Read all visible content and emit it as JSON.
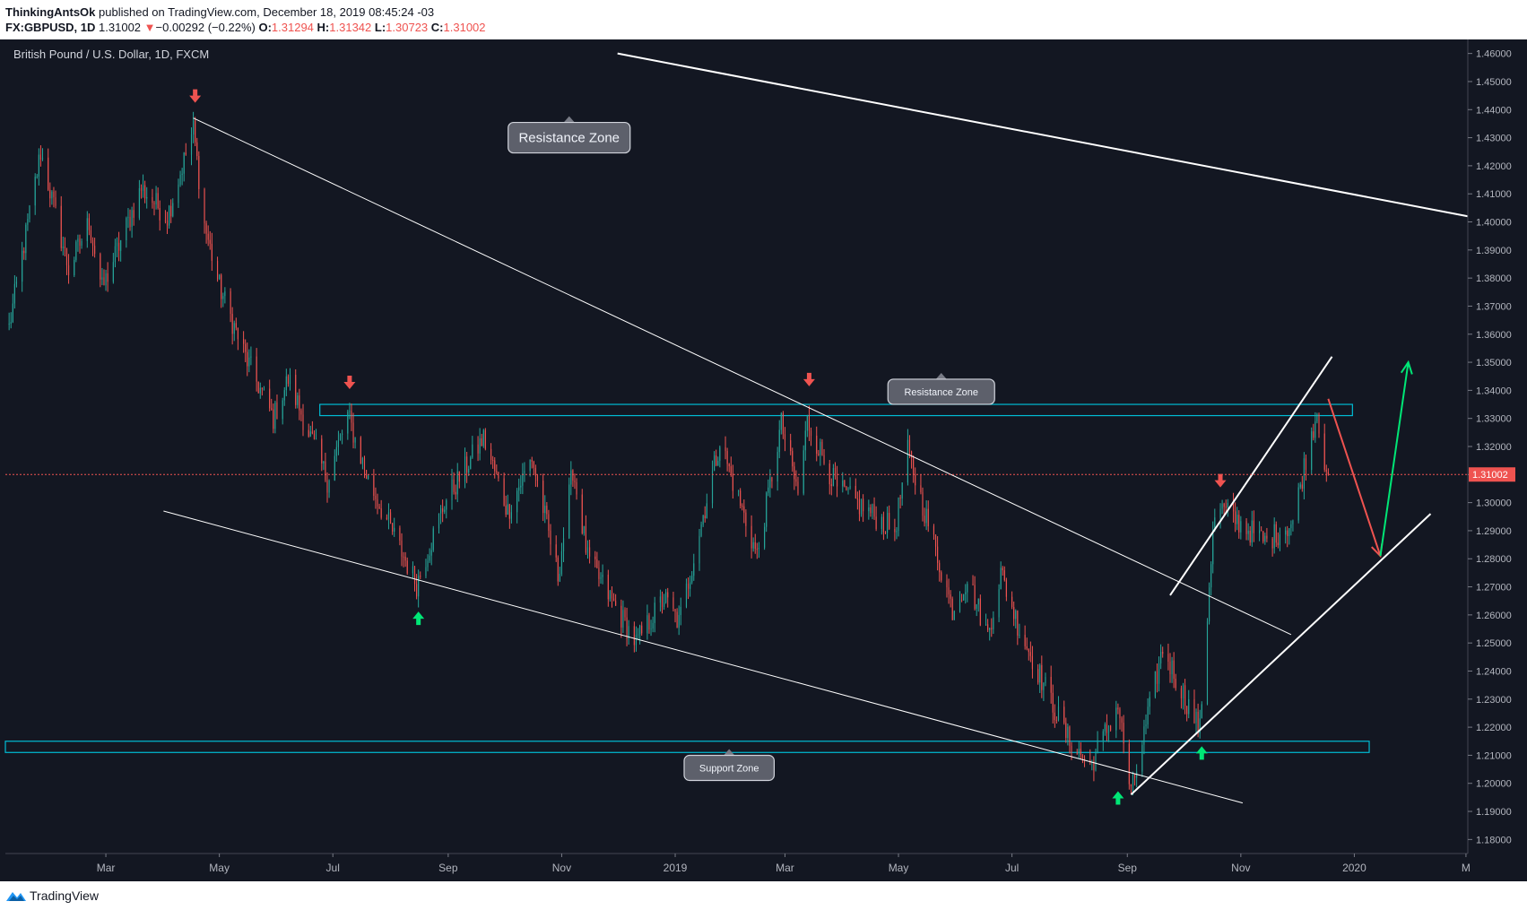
{
  "header": {
    "author": "ThinkingAntsOk",
    "published": "published on TradingView.com, December 18, 2019 08:45:24 -03",
    "symbol": "FX:GBPUSD, 1D",
    "last": "1.31002",
    "arrow": "▼",
    "change": "−0.00292 (−0.22%)",
    "o_label": "O:",
    "o_value": "1.31294",
    "h_label": "H:",
    "h_value": "1.31342",
    "l_label": "L:",
    "l_value": "1.30723",
    "c_label": "C:",
    "c_value": "1.31002"
  },
  "footer": {
    "brand": "TradingView",
    "logo_icon": "tradingview-logo-icon"
  },
  "colors": {
    "background": "#131722",
    "up": "#26a69a",
    "down": "#ef5350",
    "zone": "#00bcd4",
    "price_line": "#ef5350",
    "green_arrow": "#00e676"
  },
  "chart_data": {
    "type": "candlestick",
    "title": "British Pound / U.S. Dollar, 1D, FXCM",
    "ylim": [
      1.175,
      1.465
    ],
    "y_ticks": [
      "1.46000",
      "1.45000",
      "1.44000",
      "1.43000",
      "1.42000",
      "1.41000",
      "1.40000",
      "1.39000",
      "1.38000",
      "1.37000",
      "1.36000",
      "1.35000",
      "1.34000",
      "1.33000",
      "1.32000",
      "1.31000",
      "1.30000",
      "1.29000",
      "1.28000",
      "1.27000",
      "1.26000",
      "1.25000",
      "1.24000",
      "1.23000",
      "1.22000",
      "1.21000",
      "1.20000",
      "1.19000",
      "1.18000"
    ],
    "x_range": [
      "2018-01-06",
      "2020-03-02"
    ],
    "x_ticks": [
      {
        "date": "2018-03-01",
        "label": "Mar"
      },
      {
        "date": "2018-05-01",
        "label": "May"
      },
      {
        "date": "2018-07-01",
        "label": "Jul"
      },
      {
        "date": "2018-09-01",
        "label": "Sep"
      },
      {
        "date": "2018-11-01",
        "label": "Nov"
      },
      {
        "date": "2019-01-01",
        "label": "2019"
      },
      {
        "date": "2019-03-01",
        "label": "Mar"
      },
      {
        "date": "2019-05-01",
        "label": "May"
      },
      {
        "date": "2019-07-01",
        "label": "Jul"
      },
      {
        "date": "2019-09-01",
        "label": "Sep"
      },
      {
        "date": "2019-11-01",
        "label": "Nov"
      },
      {
        "date": "2020-01-01",
        "label": "2020"
      },
      {
        "date": "2020-03-01",
        "label": "M"
      }
    ],
    "last_price": "1.31002",
    "close_path": [
      [
        "2018-01-06",
        1.355
      ],
      [
        "2018-01-25",
        1.425
      ],
      [
        "2018-02-09",
        1.383
      ],
      [
        "2018-02-20",
        1.4
      ],
      [
        "2018-02-27",
        1.376
      ],
      [
        "2018-03-20",
        1.412
      ],
      [
        "2018-04-03",
        1.402
      ],
      [
        "2018-04-17",
        1.433
      ],
      [
        "2018-04-23",
        1.399
      ],
      [
        "2018-05-01",
        1.377
      ],
      [
        "2018-05-15",
        1.352
      ],
      [
        "2018-05-30",
        1.33
      ],
      [
        "2018-06-07",
        1.344
      ],
      [
        "2018-06-28",
        1.308
      ],
      [
        "2018-07-09",
        1.331
      ],
      [
        "2018-07-20",
        1.308
      ],
      [
        "2018-08-15",
        1.271
      ],
      [
        "2018-08-30",
        1.3
      ],
      [
        "2018-09-20",
        1.323
      ],
      [
        "2018-10-03",
        1.297
      ],
      [
        "2018-10-16",
        1.316
      ],
      [
        "2018-10-30",
        1.274
      ],
      [
        "2018-11-07",
        1.312
      ],
      [
        "2018-11-15",
        1.28
      ],
      [
        "2018-12-11",
        1.25
      ],
      [
        "2018-12-26",
        1.266
      ],
      [
        "2019-01-03",
        1.257
      ],
      [
        "2019-01-25",
        1.322
      ],
      [
        "2019-02-14",
        1.281
      ],
      [
        "2019-02-27",
        1.328
      ],
      [
        "2019-03-08",
        1.303
      ],
      [
        "2019-03-13",
        1.329
      ],
      [
        "2019-03-29",
        1.305
      ],
      [
        "2019-04-29",
        1.29
      ],
      [
        "2019-05-06",
        1.318
      ],
      [
        "2019-05-30",
        1.262
      ],
      [
        "2019-06-07",
        1.273
      ],
      [
        "2019-06-18",
        1.253
      ],
      [
        "2019-06-25",
        1.275
      ],
      [
        "2019-07-05",
        1.255
      ],
      [
        "2019-07-31",
        1.216
      ],
      [
        "2019-08-12",
        1.206
      ],
      [
        "2019-08-27",
        1.228
      ],
      [
        "2019-09-03",
        1.196
      ],
      [
        "2019-09-20",
        1.248
      ],
      [
        "2019-10-01",
        1.232
      ],
      [
        "2019-10-10",
        1.219
      ],
      [
        "2019-10-17",
        1.291
      ],
      [
        "2019-10-21",
        1.298
      ],
      [
        "2019-11-14",
        1.286
      ],
      [
        "2019-11-29",
        1.293
      ],
      [
        "2019-12-06",
        1.316
      ],
      [
        "2019-12-12",
        1.333
      ],
      [
        "2019-12-16",
        1.315
      ],
      [
        "2019-12-18",
        1.31
      ]
    ],
    "zones": [
      {
        "name": "resistance",
        "top": 1.335,
        "bottom": 1.331,
        "x_start": "2018-06-24",
        "x_end": "2019-12-31"
      },
      {
        "name": "support",
        "top": 1.215,
        "bottom": 1.211,
        "x_start": "2018-01-06",
        "x_end": "2020-01-09"
      }
    ],
    "trendlines": [
      {
        "name": "upper-long-trendline",
        "from": [
          "2018-12-01",
          1.46
        ],
        "to": [
          "2020-03-02",
          1.402
        ],
        "width": 2
      },
      {
        "name": "falling-resistance-trendline",
        "from": [
          "2018-04-17",
          1.437
        ],
        "to": [
          "2019-11-28",
          1.253
        ],
        "width": 1
      },
      {
        "name": "falling-support-trendline",
        "from": [
          "2018-04-01",
          1.297
        ],
        "to": [
          "2019-11-02",
          1.193
        ],
        "width": 1
      },
      {
        "name": "channel-upper-line",
        "from": [
          "2019-09-24",
          1.267
        ],
        "to": [
          "2019-12-20",
          1.352
        ],
        "width": 2
      },
      {
        "name": "channel-lower-line",
        "from": [
          "2019-09-03",
          1.196
        ],
        "to": [
          "2020-02-11",
          1.296
        ],
        "width": 2
      }
    ],
    "markers": [
      {
        "name": "top-arrow-apr-2018",
        "kind": "down",
        "date": "2018-04-18",
        "price": 1.437
      },
      {
        "name": "top-arrow-jul-2018",
        "kind": "down",
        "date": "2018-07-10",
        "price": 1.335
      },
      {
        "name": "top-arrow-mar-2019",
        "kind": "down",
        "date": "2019-03-14",
        "price": 1.336
      },
      {
        "name": "top-arrow-oct-2019",
        "kind": "down",
        "date": "2019-10-21",
        "price": 1.3
      },
      {
        "name": "bottom-arrow-aug-2018",
        "kind": "up",
        "date": "2018-08-16",
        "price": 1.266
      },
      {
        "name": "bottom-arrow-aug-2019",
        "kind": "up",
        "date": "2019-08-27",
        "price": 1.202
      },
      {
        "name": "bottom-arrow-oct-2019",
        "kind": "up",
        "date": "2019-10-11",
        "price": 1.218
      }
    ],
    "projection": [
      {
        "name": "projection-down-arrow",
        "color": "#ef5350",
        "from": [
          "2019-12-18",
          1.337
        ],
        "to": [
          "2020-01-15",
          1.281
        ]
      },
      {
        "name": "projection-up-arrow",
        "color": "#00e676",
        "from": [
          "2020-01-15",
          1.281
        ],
        "to": [
          "2020-01-30",
          1.35
        ]
      }
    ],
    "labels": [
      {
        "name": "resistance-zone-label-large",
        "text": "Resistance Zone",
        "date": "2018-11-05",
        "price": 1.43,
        "size": "large"
      },
      {
        "name": "resistance-zone-label-small",
        "text": "Resistance Zone",
        "date": "2019-05-24",
        "price": 1.3395,
        "size": "small"
      },
      {
        "name": "support-zone-label",
        "text": "Support Zone",
        "date": "2019-01-30",
        "price": 1.2055,
        "size": "small"
      }
    ]
  }
}
